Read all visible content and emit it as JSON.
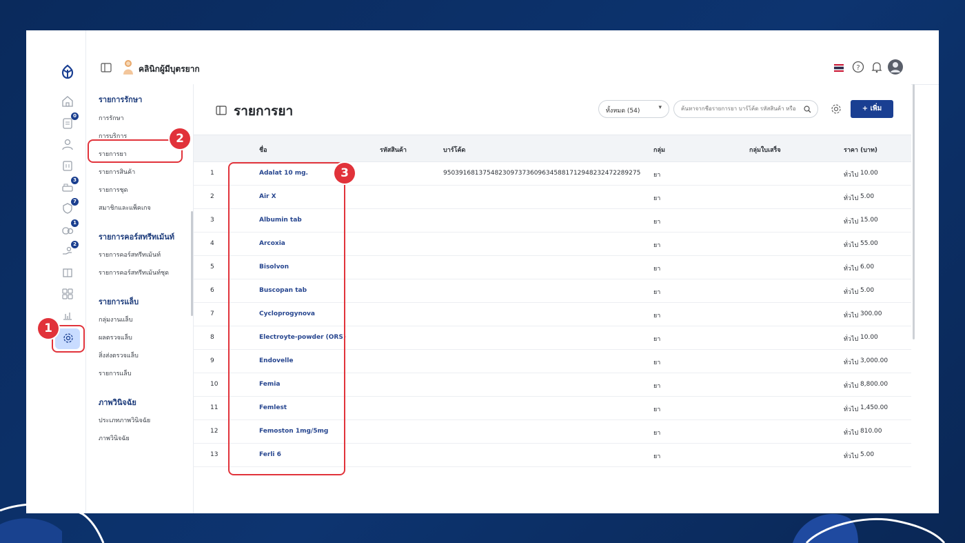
{
  "app": {
    "clinic_name": "คลินิกผู้มีบุตรยาก",
    "rail_badges": [
      "0",
      "3",
      "7",
      "1",
      "2"
    ]
  },
  "submenu": {
    "sections": [
      {
        "title": "รายการรักษา",
        "items": [
          "การรักษา",
          "การบริการ",
          "รายการยา",
          "รายการสินค้า",
          "รายการชุด",
          "สมาชิกและแพ็คเกจ"
        ]
      },
      {
        "title": "รายการคอร์สทรีทเม้นท์",
        "items": [
          "รายการคอร์สทรีทเม้นท์",
          "รายการคอร์สทรีทเม้นท์ชุด"
        ]
      },
      {
        "title": "รายการแล็บ",
        "items": [
          "กลุ่มงานแล็บ",
          "ผลตรวจแล็บ",
          "สิ่งส่งตรวจแล็บ",
          "รายการแล็บ"
        ]
      },
      {
        "title": "ภาพวินิจฉัย",
        "items": [
          "ประเภทภาพวินิจฉัย",
          "ภาพวินิจฉัย"
        ]
      }
    ]
  },
  "main": {
    "title": "รายการยา",
    "filter_value": "ทั้งหมด (54)",
    "search_placeholder": "ค้นหาจากชื่อรายการยา บาร์โค้ด รหัสสินค้า หรือ",
    "add_label": "+ เพิ่ม",
    "columns": [
      "ชื่อ",
      "รหัสสินค้า",
      "บาร์โค้ด",
      "กลุ่ม",
      "กลุ่มใบเสร็จ",
      "ราคา (บาท)"
    ],
    "rows": [
      {
        "no": "1",
        "name": "Adalat 10 mg.",
        "code": "",
        "barcode": "9503916813754823097373609634588171294823247228927​5",
        "group": "ยา",
        "receipt_group": "",
        "price_group": "ทั่วไป",
        "price": "10.00"
      },
      {
        "no": "2",
        "name": "Air X",
        "code": "",
        "barcode": "",
        "group": "ยา",
        "receipt_group": "",
        "price_group": "ทั่วไป",
        "price": "5.00"
      },
      {
        "no": "3",
        "name": "Albumin tab",
        "code": "",
        "barcode": "",
        "group": "ยา",
        "receipt_group": "",
        "price_group": "ทั่วไป",
        "price": "15.00"
      },
      {
        "no": "4",
        "name": "Arcoxia",
        "code": "",
        "barcode": "",
        "group": "ยา",
        "receipt_group": "",
        "price_group": "ทั่วไป",
        "price": "55.00"
      },
      {
        "no": "5",
        "name": "Bisolvon",
        "code": "",
        "barcode": "",
        "group": "ยา",
        "receipt_group": "",
        "price_group": "ทั่วไป",
        "price": "6.00"
      },
      {
        "no": "6",
        "name": "Buscopan tab",
        "code": "",
        "barcode": "",
        "group": "ยา",
        "receipt_group": "",
        "price_group": "ทั่วไป",
        "price": "5.00"
      },
      {
        "no": "7",
        "name": "Cycloprogynova",
        "code": "",
        "barcode": "",
        "group": "ยา",
        "receipt_group": "",
        "price_group": "ทั่วไป",
        "price": "300.00"
      },
      {
        "no": "8",
        "name": "Electroyte-powder (ORS)",
        "code": "",
        "barcode": "",
        "group": "ยา",
        "receipt_group": "",
        "price_group": "ทั่วไป",
        "price": "10.00"
      },
      {
        "no": "9",
        "name": "Endovelle",
        "code": "",
        "barcode": "",
        "group": "ยา",
        "receipt_group": "",
        "price_group": "ทั่วไป",
        "price": "3,000.00"
      },
      {
        "no": "10",
        "name": "Femia",
        "code": "",
        "barcode": "",
        "group": "ยา",
        "receipt_group": "",
        "price_group": "ทั่วไป",
        "price": "8,800.00"
      },
      {
        "no": "11",
        "name": "Femlest",
        "code": "",
        "barcode": "",
        "group": "ยา",
        "receipt_group": "",
        "price_group": "ทั่วไป",
        "price": "1,450.00"
      },
      {
        "no": "12",
        "name": "Femoston 1mg/5mg",
        "code": "",
        "barcode": "",
        "group": "ยา",
        "receipt_group": "",
        "price_group": "ทั่วไป",
        "price": "810.00"
      },
      {
        "no": "13",
        "name": "Ferli 6",
        "code": "",
        "barcode": "",
        "group": "ยา",
        "receipt_group": "",
        "price_group": "ทั่วไป",
        "price": "5.00"
      }
    ]
  },
  "annotations": {
    "step1": "1",
    "step2": "2",
    "step3": "3"
  },
  "colors": {
    "accent": "#1a3f92",
    "highlight": "#e1323a",
    "background": "#0d3470"
  }
}
